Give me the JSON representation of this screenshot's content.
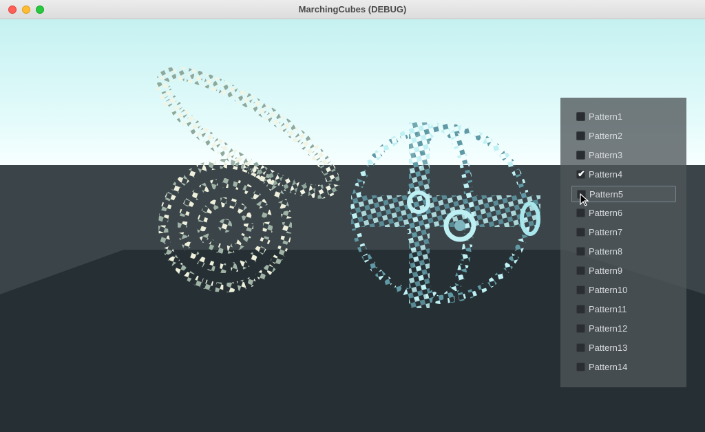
{
  "window": {
    "title": "MarchingCubes (DEBUG)"
  },
  "panel": {
    "items": [
      {
        "label": "Pattern1",
        "checked": false
      },
      {
        "label": "Pattern2",
        "checked": false
      },
      {
        "label": "Pattern3",
        "checked": false
      },
      {
        "label": "Pattern4",
        "checked": true
      },
      {
        "label": "Pattern5",
        "checked": false
      },
      {
        "label": "Pattern6",
        "checked": false
      },
      {
        "label": "Pattern7",
        "checked": false
      },
      {
        "label": "Pattern8",
        "checked": false
      },
      {
        "label": "Pattern9",
        "checked": false
      },
      {
        "label": "Pattern10",
        "checked": false
      },
      {
        "label": "Pattern11",
        "checked": false
      },
      {
        "label": "Pattern12",
        "checked": false
      },
      {
        "label": "Pattern13",
        "checked": false
      },
      {
        "label": "Pattern14",
        "checked": false
      }
    ],
    "check_glyph": "✔"
  },
  "colors": {
    "sky_top": "#c9f2f2",
    "sky_horizon": "#f2ffff",
    "ground": "#2b3338",
    "sphere_left": "#e6ebd6",
    "sphere_right": "#a8e6ec"
  }
}
